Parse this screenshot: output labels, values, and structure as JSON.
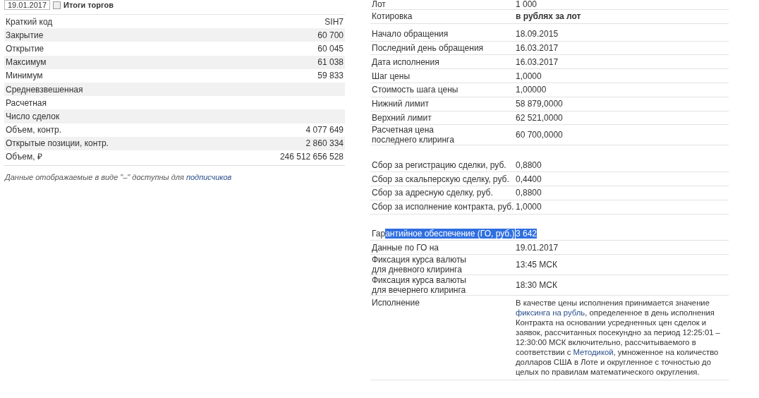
{
  "filter": {
    "date": "19.01.2017",
    "checkbox_checked": false,
    "checkbox_label": "Итоги торгов"
  },
  "summary": {
    "rows": [
      {
        "label": "Краткий код",
        "value": "SIH7"
      },
      {
        "label": "Закрытие",
        "value": "60 700"
      },
      {
        "label": "Открытие",
        "value": "60 045"
      },
      {
        "label": "Максимум",
        "value": "61 038"
      },
      {
        "label": "Минимум",
        "value": "59 833"
      },
      {
        "label": "Средневзвешенная"
      },
      {
        "label": "Расчетная"
      },
      {
        "label": "Число сделок"
      },
      {
        "label": "Объем, контр.",
        "value": "4 077 649"
      },
      {
        "label": "Открытые позиции, контр.",
        "value": "2 860 334"
      },
      {
        "label": "Объем, ₽",
        "value": "246 512 656 528"
      }
    ],
    "note": "Данные отображаемые в виде \"–\" доступны для ",
    "note_link": "подписчиков"
  },
  "specs": {
    "groups": [
      {
        "rows": [
          {
            "label": "Лот",
            "value": "1 000"
          },
          {
            "label": "Котировка",
            "value": "в рублях за лот"
          }
        ]
      },
      {
        "rows": [
          {
            "label": "Начало обращения",
            "value": "18.09.2015"
          },
          {
            "label": "Последний день обращения",
            "value": "16.03.2017"
          },
          {
            "label": "Дата исполнения",
            "value": "16.03.2017"
          },
          {
            "label": "Шаг цены",
            "value": "1,0000"
          },
          {
            "label": "Стоимость шага цены",
            "value": "1,00000"
          },
          {
            "label": "Нижний лимит",
            "value": "58 879,0000"
          },
          {
            "label": "Верхний лимит",
            "value": "62 521,0000"
          },
          {
            "label": "Расчетная цена\nпоследнего клиринга",
            "value": "60 700,0000"
          }
        ]
      },
      {
        "rows": [
          {
            "label": "Сбор за регистрацию сделки, руб.",
            "value": "0,8800"
          },
          {
            "label": "Сбор за скальперскую сделку, руб.",
            "value": "0,4400"
          },
          {
            "label": "Сбор за адресную сделку, руб.",
            "value": "0,8800"
          },
          {
            "label": "Сбор за исполнение контракта, руб.",
            "value": "1,0000"
          }
        ]
      },
      {
        "rows": [
          {
            "label": "Гар",
            "label_selected": "антийное обеспечение (ГО, руб.)",
            "value": "3 642",
            "selected": true
          },
          {
            "label": "Данные по ГО на",
            "value": "19.01.2017"
          },
          {
            "label": "Фиксация курса валюты\nдля дневного клиринга",
            "value": "13:45 МСК"
          },
          {
            "label": "Фиксация курса валюты\nдля вечернего клиринга",
            "value": "18:30 МСК"
          },
          {
            "label": "Исполнение",
            "value_parts": [
              {
                "kind": "text",
                "text": "В качестве цены исполнения принимается значение "
              },
              {
                "kind": "link",
                "text": "фиксинга на рубль"
              },
              {
                "kind": "text",
                "text": ", определенное в день исполнения Контракта на основании усредненных цен сделок и заявок, рассчитанных посекундно за период 12:25:01 – 12:30:00 МСК включительно, рассчитываемого в соответствии с "
              },
              {
                "kind": "link",
                "text": "Методикой"
              },
              {
                "kind": "text",
                "text": ", умноженное на количество долларов США в Лоте и округленное с точностью до целых по правилам математического округления."
              }
            ]
          }
        ]
      }
    ]
  }
}
